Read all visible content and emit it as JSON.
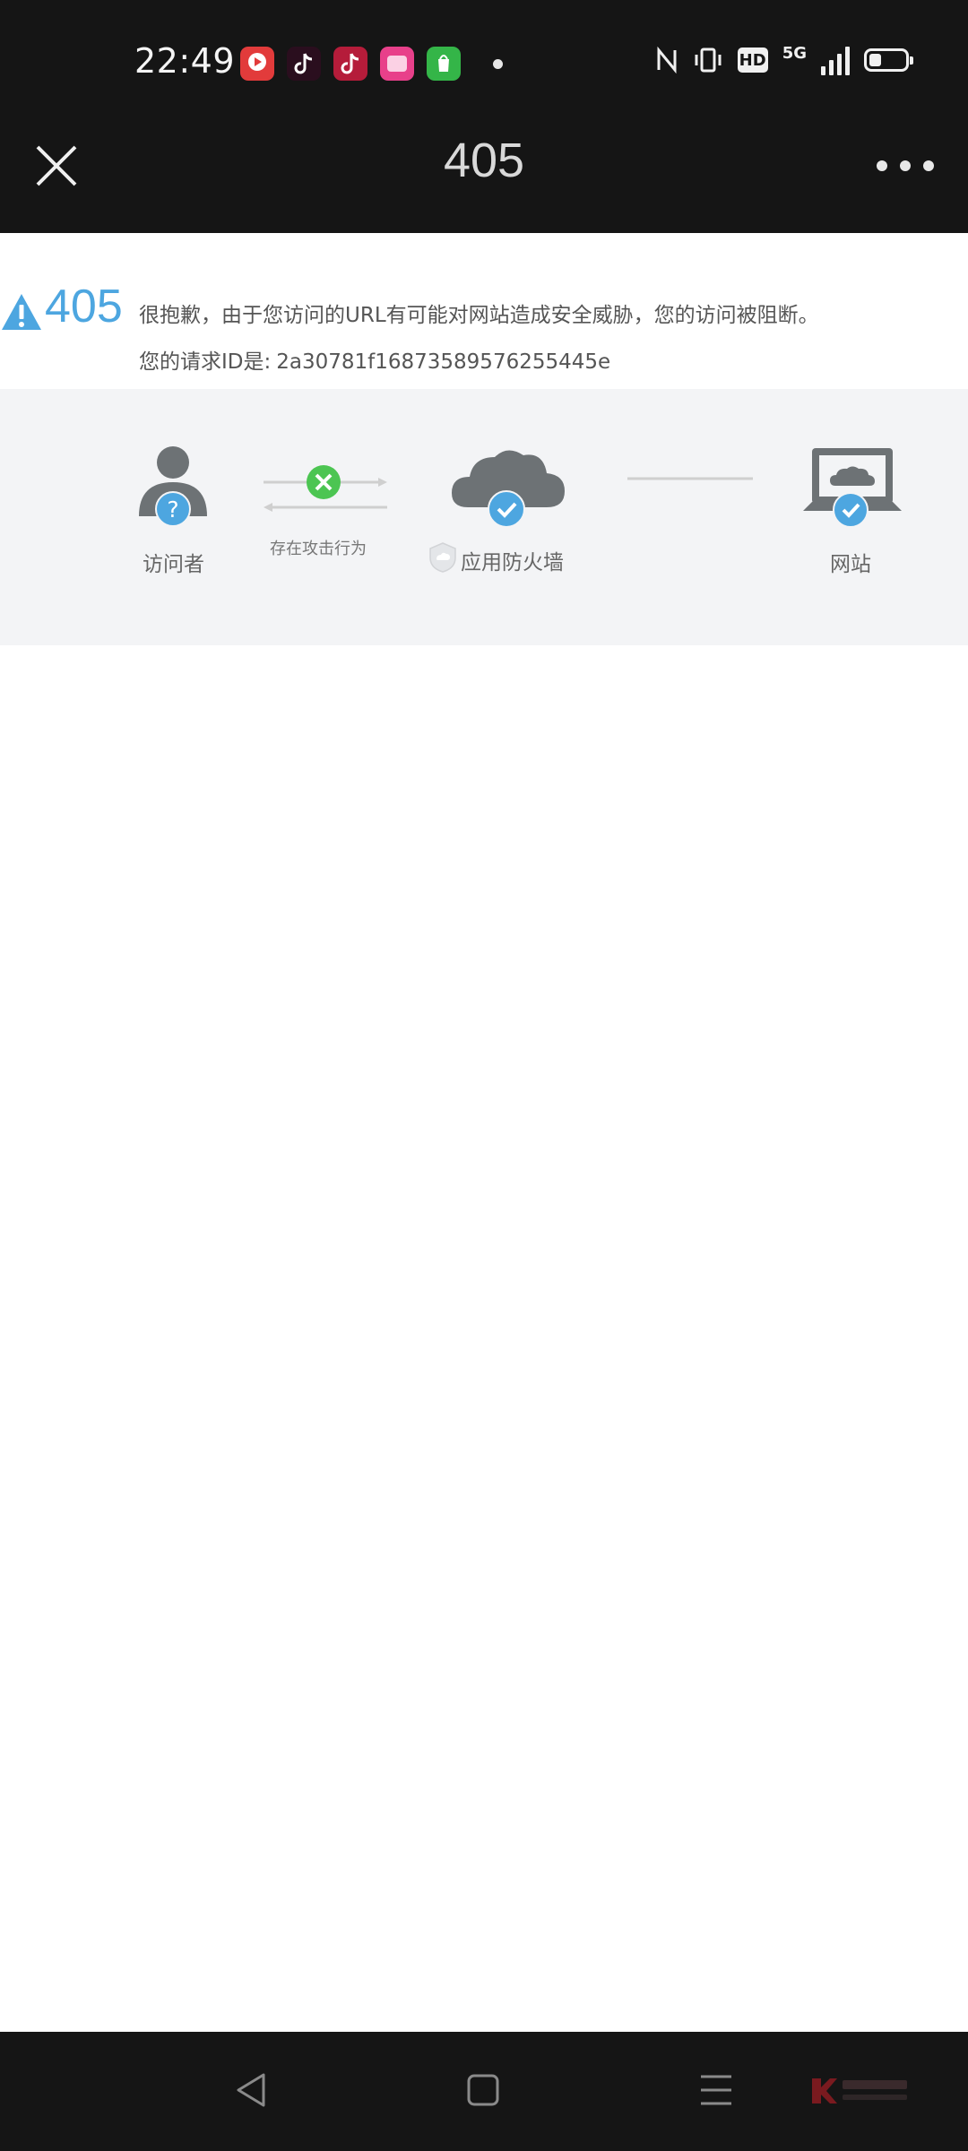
{
  "status_bar": {
    "time": "22:49",
    "network": "5G",
    "hd_label": "HD",
    "battery_level": 0.35
  },
  "titlebar": {
    "title": "405"
  },
  "error": {
    "code": "405",
    "message": "很抱歉，由于您访问的URL有可能对网站造成安全威胁，您的访问被阻断。",
    "request_id_label": "您的请求ID是:",
    "request_id": "2a30781f16873589576255445e"
  },
  "diagram": {
    "visitor_label": "访问者",
    "attack_label": "存在攻击行为",
    "firewall_label": "应用防火墙",
    "website_label": "网站"
  },
  "colors": {
    "accent_blue": "#4da6e0",
    "success_green": "#4cc552",
    "icon_gray": "#6d7275"
  }
}
